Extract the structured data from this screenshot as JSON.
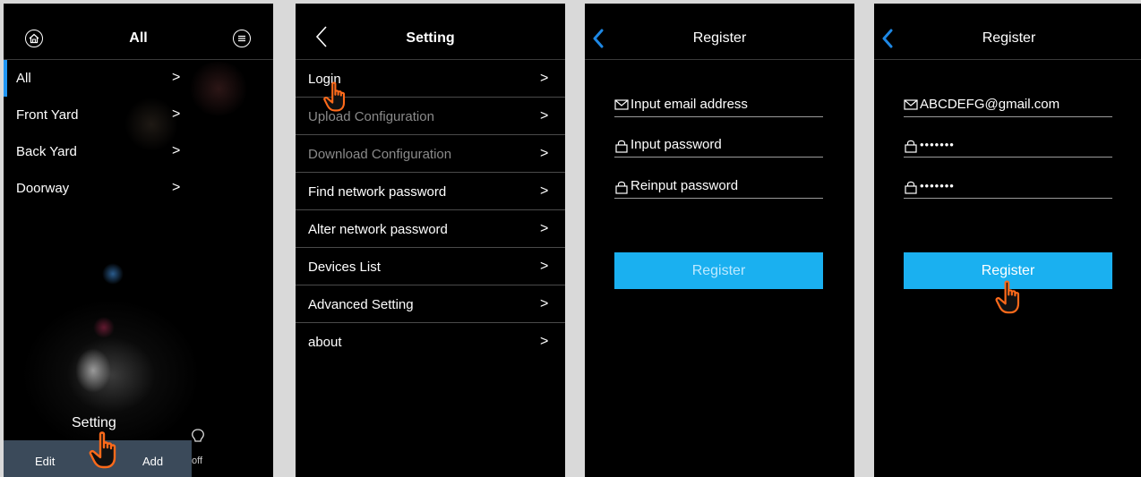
{
  "screen1": {
    "title": "All",
    "groups": [
      {
        "label": "All",
        "selected": true
      },
      {
        "label": "Front Yard",
        "selected": false
      },
      {
        "label": "Back Yard",
        "selected": false
      },
      {
        "label": "Doorway",
        "selected": false
      }
    ],
    "chevron": ">",
    "setting_label": "Setting",
    "toolbar": {
      "edit": "Edit",
      "add": "Add"
    },
    "off_label": "off"
  },
  "screen2": {
    "title": "Setting",
    "items": [
      {
        "label": "Login",
        "enabled": true
      },
      {
        "label": "Upload Configuration",
        "enabled": false
      },
      {
        "label": "Download Configuration",
        "enabled": false
      },
      {
        "label": "Find network password",
        "enabled": true
      },
      {
        "label": "Alter network password",
        "enabled": true
      },
      {
        "label": "Devices List",
        "enabled": true
      },
      {
        "label": "Advanced Setting",
        "enabled": true
      },
      {
        "label": "about",
        "enabled": true
      }
    ],
    "chevron": ">"
  },
  "screen3": {
    "title": "Register",
    "email_placeholder": "Input email address",
    "password_placeholder": "Input password",
    "reinput_placeholder": "Reinput password",
    "button": "Register"
  },
  "screen4": {
    "title": "Register",
    "email_value": "ABCDEFG@gmail.com",
    "password_value": "•••••••",
    "reinput_value": "•••••••",
    "button": "Register"
  },
  "colors": {
    "accent": "#1ab0f0",
    "selection_bar": "#2196f3",
    "back_arrow": "#1e88e5",
    "pointer_hand": "#ff6a1a",
    "toolbar_bg": "#3b4a5a"
  }
}
